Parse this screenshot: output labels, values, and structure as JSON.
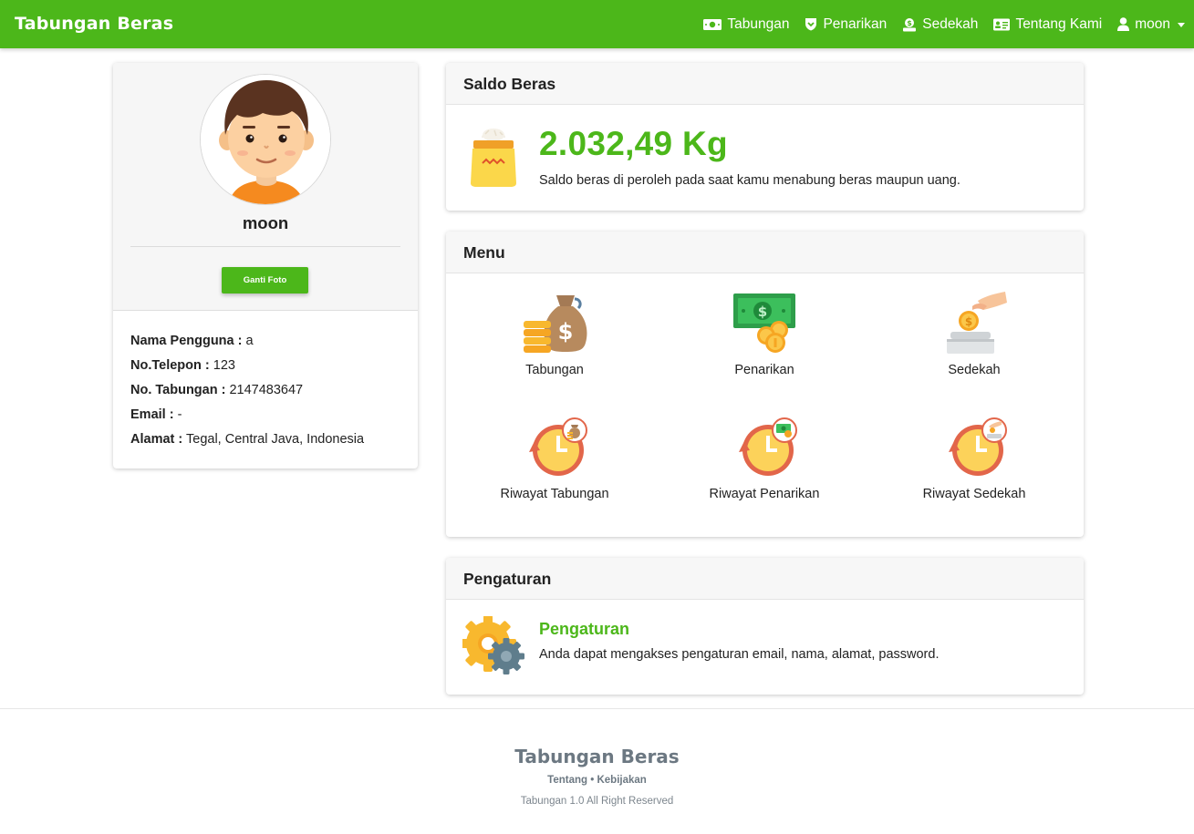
{
  "navbar": {
    "brand": "Tabungan Beras",
    "items": [
      {
        "label": "Tabungan",
        "icon": "money-bill-icon"
      },
      {
        "label": "Penarikan",
        "icon": "shield-icon"
      },
      {
        "label": "Sedekah",
        "icon": "donate-icon"
      },
      {
        "label": "Tentang Kami",
        "icon": "id-card-icon"
      },
      {
        "label": "moon",
        "icon": "user-icon"
      }
    ]
  },
  "profile": {
    "name": "moon",
    "change_photo_label": "Ganti Foto",
    "fields": [
      {
        "label": "Nama Pengguna :",
        "value": "a"
      },
      {
        "label": "No.Telepon :",
        "value": "123"
      },
      {
        "label": "No. Tabungan :",
        "value": "2147483647"
      },
      {
        "label": "Email :",
        "value": "-"
      },
      {
        "label": "Alamat :",
        "value": "Tegal, Central Java, Indonesia"
      }
    ]
  },
  "saldo": {
    "title": "Saldo Beras",
    "value": "2.032,49 Kg",
    "description": "Saldo beras di peroleh pada saat kamu menabung beras maupun uang."
  },
  "menu": {
    "title": "Menu",
    "items": [
      {
        "label": "Tabungan",
        "icon": "money-bag-icon"
      },
      {
        "label": "Penarikan",
        "icon": "cash-coins-icon"
      },
      {
        "label": "Sedekah",
        "icon": "hand-coin-icon"
      },
      {
        "label": "Riwayat Tabungan",
        "icon": "history-clock-icon"
      },
      {
        "label": "Riwayat Penarikan",
        "icon": "history-clock-icon"
      },
      {
        "label": "Riwayat Sedekah",
        "icon": "history-clock-icon"
      }
    ]
  },
  "settings": {
    "title": "Pengaturan",
    "link_label": "Pengaturan",
    "description": "Anda dapat mengakses pengaturan email, nama, alamat, password."
  },
  "footer": {
    "brand": "Tabungan Beras",
    "link_about": "Tentang",
    "separator": "•",
    "link_policy": "Kebijakan",
    "copyright": "Tabungan 1.0 All Right Reserved"
  },
  "colors": {
    "primary": "#4cb71a",
    "footer_text": "#6c7882"
  }
}
